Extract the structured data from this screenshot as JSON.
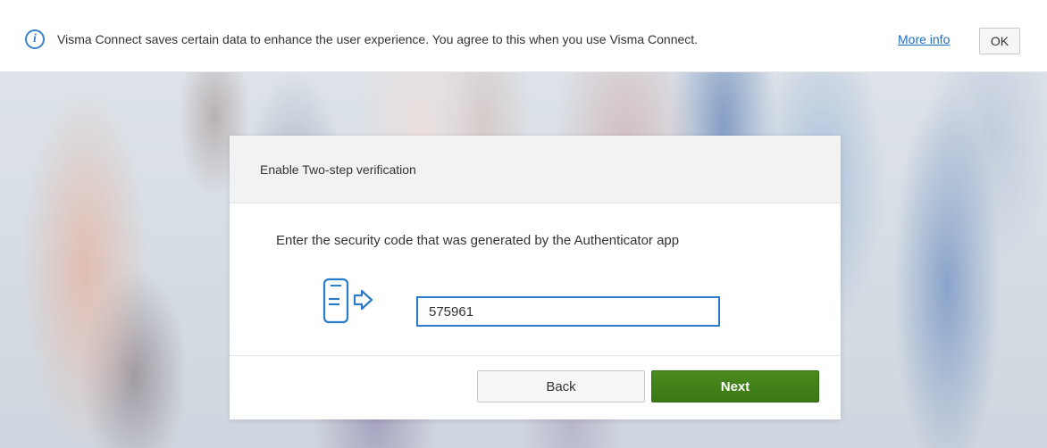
{
  "cookie_banner": {
    "message": "Visma Connect saves certain data to enhance the user experience. You agree to this when you use Visma Connect.",
    "more_info_label": "More info",
    "ok_label": "OK",
    "icon": "info-icon"
  },
  "dialog": {
    "title": "Enable Two-step verification",
    "instruction": "Enter the security code that was generated by the Authenticator app",
    "phone_icon": "phone-arrow-icon",
    "code_input": {
      "value": "575961"
    },
    "back_label": "Back",
    "next_label": "Next"
  },
  "colors": {
    "accent_blue": "#2a7bc9",
    "primary_green": "#3f7d18",
    "link_blue": "#1d6ec4"
  }
}
